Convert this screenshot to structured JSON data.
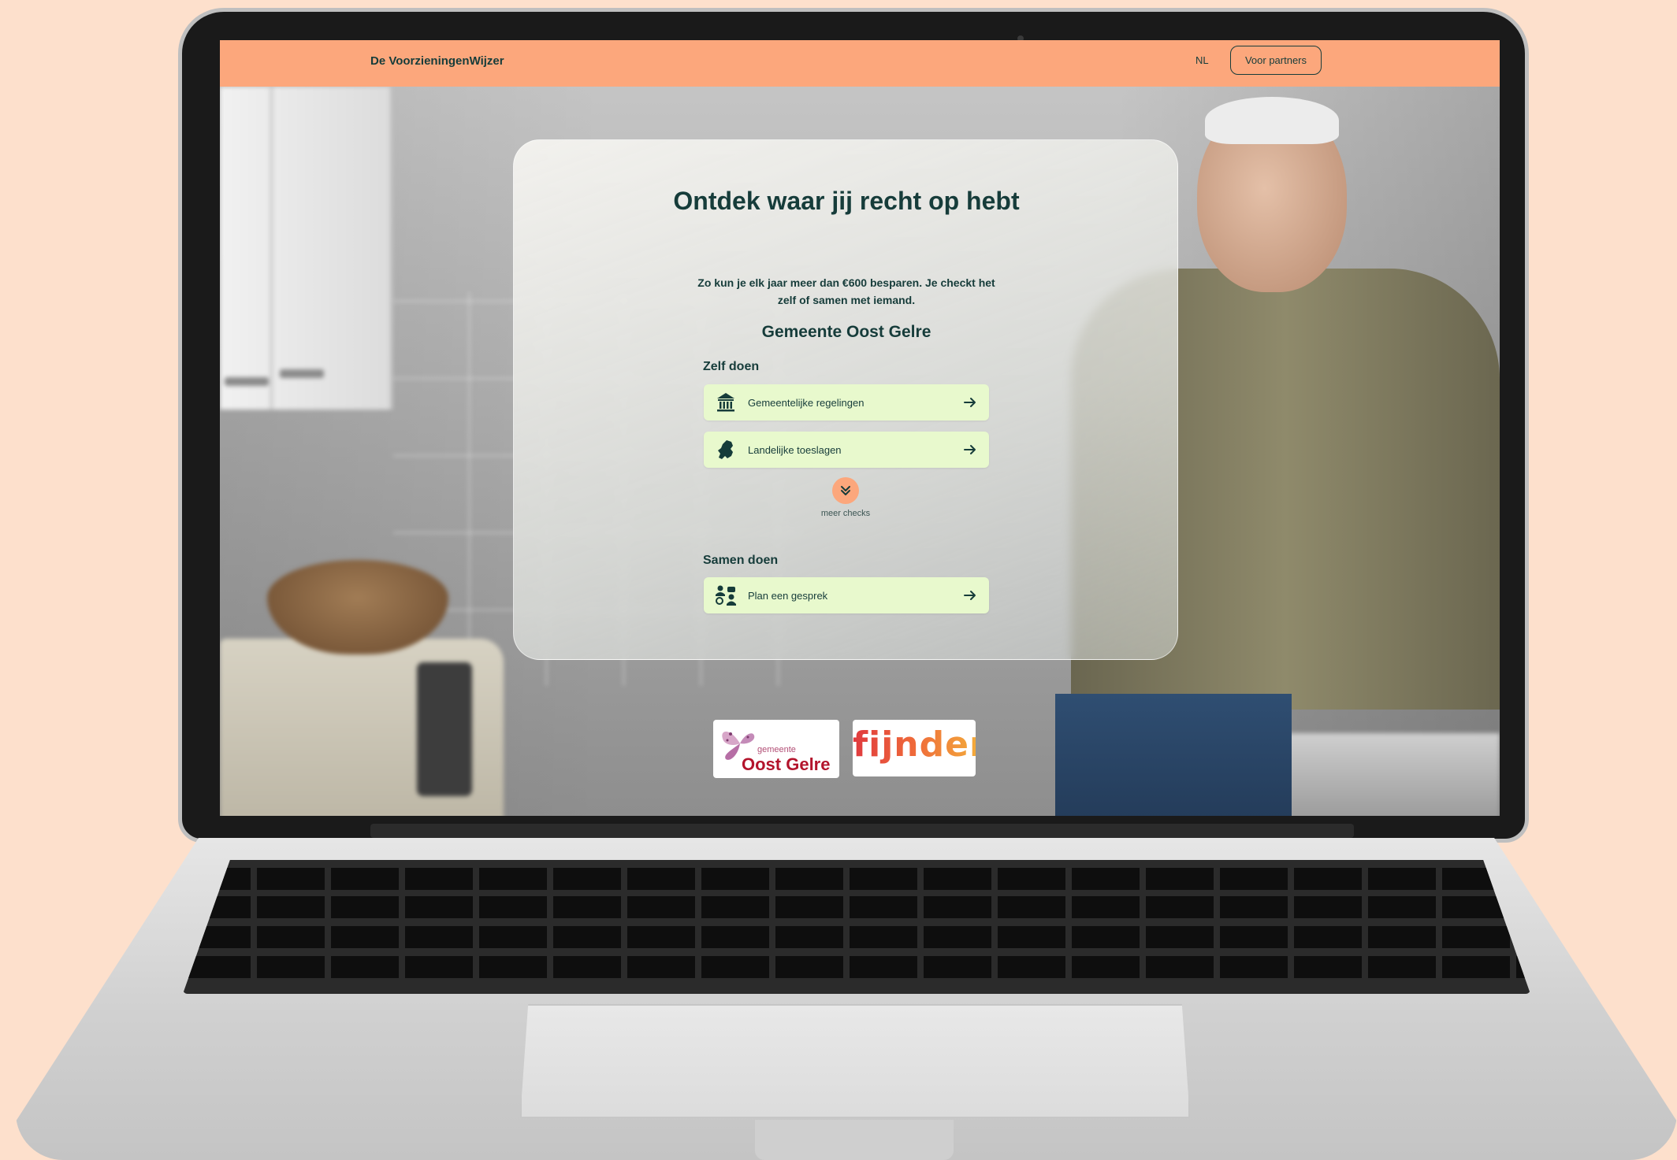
{
  "nav": {
    "brand": "De VoorzieningenWijzer",
    "language": "NL",
    "partners_button": "Voor partners"
  },
  "hero": {
    "title": "Ontdek waar jij recht op hebt",
    "subtitle": "Zo kun je elk jaar meer dan €600 besparen. Je checkt het zelf of samen met iemand.",
    "municipality": "Gemeente Oost Gelre"
  },
  "self_section": {
    "label": "Zelf doen",
    "items": [
      {
        "label": "Gemeentelijke regelingen",
        "icon": "government-building-icon"
      },
      {
        "label": "Landelijke toeslagen",
        "icon": "netherlands-map-icon"
      }
    ],
    "more_label": "meer checks"
  },
  "together_section": {
    "label": "Samen doen",
    "items": [
      {
        "label": "Plan een gesprek",
        "icon": "people-meeting-icon"
      }
    ]
  },
  "logos": {
    "oost_gelre_small": "gemeente",
    "oost_gelre_big": "Oost Gelre",
    "fijnder": "fijnder"
  },
  "colors": {
    "nav_bg": "#fca77c",
    "text_dark": "#163c3a",
    "button_bg": "#e8f9cd",
    "accent": "#fca77c",
    "background": "#fde0cc"
  }
}
